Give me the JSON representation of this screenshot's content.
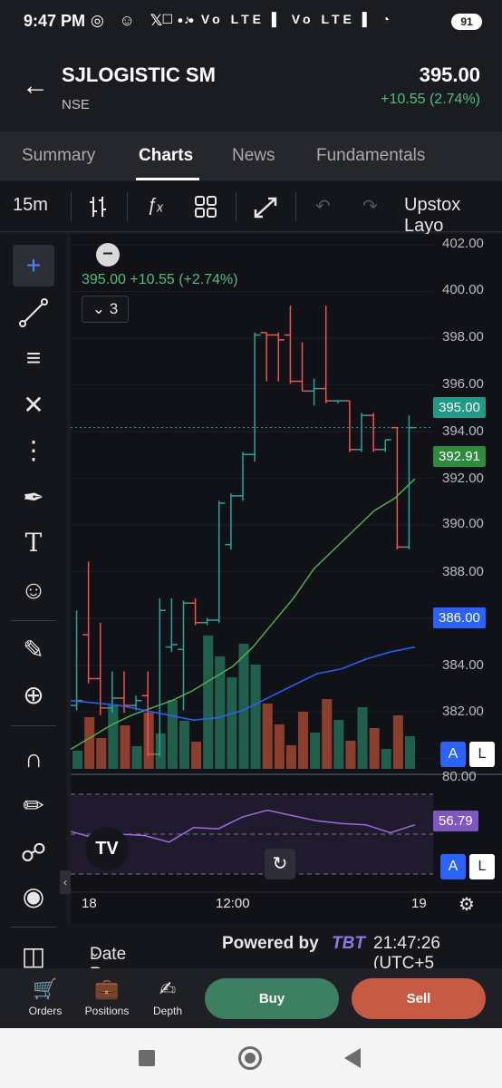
{
  "status_bar": {
    "time": "9:47 PM",
    "notif_icons": "◎ ☺ 𝕏 ••",
    "right_icons": "☐ ♪ Vo LTE ▌ Vo LTE ▌ ◔",
    "battery": "91"
  },
  "header": {
    "back_icon": "arrow-left-icon",
    "ticker": "SJLOGISTIC SM",
    "exchange": "NSE",
    "price": "395.00",
    "change": "+10.55 (2.74%)"
  },
  "tabs": [
    {
      "label": "Summary",
      "active": false
    },
    {
      "label": "Charts",
      "active": true
    },
    {
      "label": "News",
      "active": false
    },
    {
      "label": "Fundamentals",
      "active": false
    }
  ],
  "toolbar": {
    "interval": "15m",
    "layout_label": "Upstox Layo"
  },
  "chart": {
    "header_line": "395.00  +10.55 (+2.74%)",
    "indicator_count": "3",
    "price_axis": [
      "402.00",
      "400.00",
      "398.00",
      "396.00",
      "394.00",
      "392.00",
      "390.00",
      "388.00",
      "384.00",
      "382.00"
    ],
    "tags": {
      "last_price": "395.00",
      "ma_short": "392.91",
      "ma_long": "386.00",
      "rsi": "56.79"
    },
    "rsi_axis_top": "80.00",
    "time_axis": [
      "18",
      "12:00",
      "19"
    ],
    "auto_label": "A",
    "log_label": "L",
    "colors": {
      "up": "#26a69a",
      "down": "#ef5350",
      "ma_short": "#4caf50",
      "ma_long": "#2962ff",
      "rsi": "#9c6ade"
    }
  },
  "chart_data": {
    "type": "candlestick",
    "ylim": [
      381,
      402.5
    ],
    "candles": [
      {
        "o": 383.6,
        "h": 387.5,
        "l": 383.4,
        "c": 383.8
      },
      {
        "o": 386.5,
        "h": 389.5,
        "l": 384.5,
        "c": 384.7
      },
      {
        "o": 384.7,
        "h": 387.0,
        "l": 383.2,
        "c": 383.5
      },
      {
        "o": 383.5,
        "h": 385.0,
        "l": 383.3,
        "c": 383.9
      },
      {
        "o": 383.9,
        "h": 385.0,
        "l": 383.3,
        "c": 383.6
      },
      {
        "o": 383.6,
        "h": 384.0,
        "l": 383.4,
        "c": 383.8
      },
      {
        "o": 384.0,
        "h": 385.0,
        "l": 381.5,
        "c": 381.6
      },
      {
        "o": 381.6,
        "h": 388.0,
        "l": 381.5,
        "c": 387.5
      },
      {
        "o": 386.0,
        "h": 388.0,
        "l": 385.8,
        "c": 386.1
      },
      {
        "o": 385.9,
        "h": 387.9,
        "l": 383.4,
        "c": 387.8
      },
      {
        "o": 387.8,
        "h": 388.0,
        "l": 386.9,
        "c": 387.0
      },
      {
        "o": 387.0,
        "h": 387.2,
        "l": 386.9,
        "c": 387.1
      },
      {
        "o": 387.1,
        "h": 392.0,
        "l": 387.0,
        "c": 391.9
      },
      {
        "o": 390.2,
        "h": 392.3,
        "l": 390.0,
        "c": 392.2
      },
      {
        "o": 392.2,
        "h": 394.0,
        "l": 392.0,
        "c": 393.9
      },
      {
        "o": 393.9,
        "h": 398.9,
        "l": 393.6,
        "c": 398.8
      },
      {
        "o": 398.9,
        "h": 398.9,
        "l": 396.9,
        "c": 398.8
      },
      {
        "o": 398.8,
        "h": 398.9,
        "l": 396.9,
        "c": 398.6
      },
      {
        "o": 398.8,
        "h": 400.0,
        "l": 396.8,
        "c": 396.9
      },
      {
        "o": 396.9,
        "h": 398.5,
        "l": 396.5,
        "c": 396.5
      },
      {
        "o": 396.5,
        "h": 397.0,
        "l": 395.9,
        "c": 396.6
      },
      {
        "o": 396.6,
        "h": 400.0,
        "l": 396.0,
        "c": 396.1
      },
      {
        "o": 396.1,
        "h": 396.1,
        "l": 396.0,
        "c": 396.1
      },
      {
        "o": 396.1,
        "h": 396.1,
        "l": 394.0,
        "c": 394.1
      },
      {
        "o": 394.1,
        "h": 395.6,
        "l": 394.0,
        "c": 395.5
      },
      {
        "o": 395.5,
        "h": 395.6,
        "l": 394.0,
        "c": 394.1
      },
      {
        "o": 394.1,
        "h": 394.5,
        "l": 394.0,
        "c": 394.5
      },
      {
        "o": 395.0,
        "h": 395.0,
        "l": 390.0,
        "c": 390.1
      },
      {
        "o": 390.1,
        "h": 395.5,
        "l": 390.0,
        "c": 395.0
      }
    ],
    "ma_short": [
      381.8,
      382.3,
      382.8,
      383.2,
      383.5,
      383.8,
      384.2,
      384.7,
      385.2,
      386.0,
      387.0,
      388.0,
      389.2,
      390.0,
      390.8,
      391.6,
      392.1,
      392.9
    ],
    "ma_long": [
      383.8,
      383.7,
      383.6,
      383.4,
      383.2,
      383.0,
      383.1,
      383.4,
      383.9,
      384.4,
      384.9,
      385.1,
      385.5,
      385.8,
      386.0
    ],
    "rsi": [
      52,
      47,
      50,
      49,
      44,
      55,
      54,
      63,
      68,
      64,
      60,
      58,
      57,
      51,
      57
    ]
  },
  "left_tools": [
    "crosshair-icon",
    "trendline-icon",
    "fib-icon",
    "pattern-icon",
    "prediction-icon",
    "brush-icon",
    "text-icon",
    "emoji-icon",
    "ruler-icon",
    "zoom-in-icon",
    "magnet-icon",
    "lock-drawing-icon",
    "lock-icon",
    "eye-icon",
    "trash-icon"
  ],
  "info_row": {
    "date_range": "Date Range",
    "powered_by": "Powered by",
    "brand": "TBT",
    "time": "21:47:26 (UTC+5"
  },
  "bottom_nav": [
    {
      "label": "Orders"
    },
    {
      "label": "Positions"
    },
    {
      "label": "Depth"
    }
  ],
  "actions": {
    "buy": "Buy",
    "sell": "Sell"
  }
}
